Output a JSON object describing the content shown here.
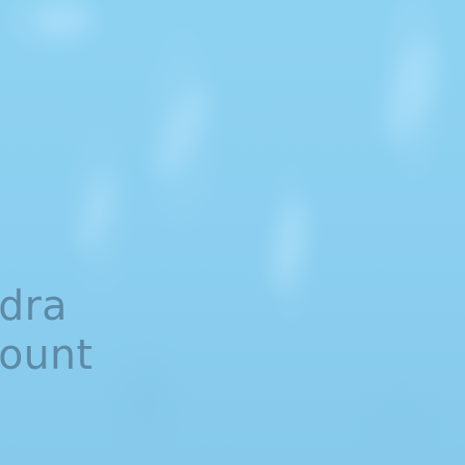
{
  "background": {
    "primary_color": "#8dcfef",
    "highlight_color": "#b3e3fa",
    "texture": "water-ripple"
  },
  "title": {
    "line1": "dra",
    "line2": "ount",
    "color": "#5e8aa3"
  }
}
